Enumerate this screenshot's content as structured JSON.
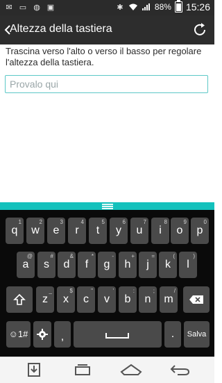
{
  "status": {
    "battery": "88%",
    "time": "15:26"
  },
  "header": {
    "title": "Altezza della tastiera"
  },
  "content": {
    "description": "Trascina verso l'alto o verso il basso per regolare l'altezza della tastiera.",
    "input_placeholder": "Provalo qui"
  },
  "keyboard": {
    "row1": [
      {
        "label": "q",
        "hint": "1"
      },
      {
        "label": "w",
        "hint": "2"
      },
      {
        "label": "e",
        "hint": "3"
      },
      {
        "label": "r",
        "hint": "4"
      },
      {
        "label": "t",
        "hint": "5"
      },
      {
        "label": "y",
        "hint": "6"
      },
      {
        "label": "u",
        "hint": "7"
      },
      {
        "label": "i",
        "hint": "8"
      },
      {
        "label": "o",
        "hint": "9"
      },
      {
        "label": "p",
        "hint": "0"
      }
    ],
    "row2": [
      {
        "label": "a",
        "hint": "@"
      },
      {
        "label": "s",
        "hint": "#"
      },
      {
        "label": "d",
        "hint": "&"
      },
      {
        "label": "f",
        "hint": "*"
      },
      {
        "label": "g",
        "hint": "-"
      },
      {
        "label": "h",
        "hint": "+"
      },
      {
        "label": "j",
        "hint": "="
      },
      {
        "label": "k",
        "hint": "("
      },
      {
        "label": "l",
        "hint": ")"
      }
    ],
    "row3": [
      {
        "label": "z",
        "hint": "_"
      },
      {
        "label": "x",
        "hint": "$"
      },
      {
        "label": "c",
        "hint": "\""
      },
      {
        "label": "v",
        "hint": "'"
      },
      {
        "label": "b",
        "hint": ":"
      },
      {
        "label": "n",
        "hint": ";"
      },
      {
        "label": "m",
        "hint": "/"
      }
    ],
    "symbols_label": "☺1#",
    "period_label": ".",
    "enter_label": "Salva"
  },
  "icons": {
    "back": "chevron-left-icon",
    "reset": "refresh-icon",
    "shift": "shift-icon",
    "delete": "backspace-icon",
    "settings": "gear-icon",
    "nav_download": "download-icon",
    "nav_recent": "recent-apps-icon",
    "nav_home": "home-icon",
    "nav_back": "back-icon"
  }
}
